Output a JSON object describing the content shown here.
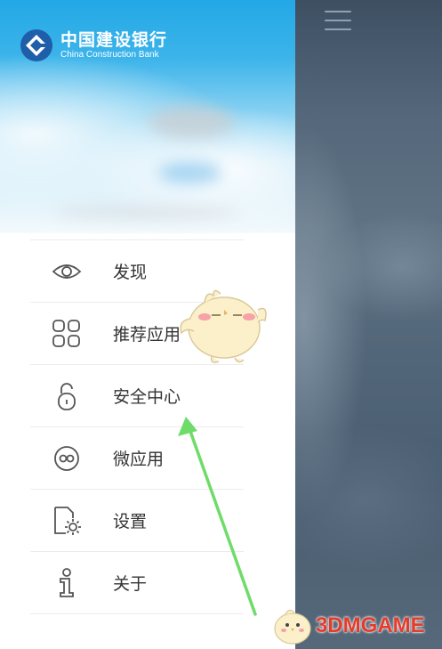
{
  "header": {
    "bank_name_cn": "中国建设银行",
    "bank_name_en": "China Construction Bank"
  },
  "menu": {
    "items": [
      {
        "label": "发现",
        "icon": "eye-icon"
      },
      {
        "label": "推荐应用",
        "icon": "grid-icon"
      },
      {
        "label": "安全中心",
        "icon": "lock-icon"
      },
      {
        "label": "微应用",
        "icon": "infinity-icon"
      },
      {
        "label": "设置",
        "icon": "settings-doc-icon"
      },
      {
        "label": "关于",
        "icon": "info-person-icon"
      }
    ]
  },
  "watermark": {
    "text": "3DMGAME"
  },
  "colors": {
    "header_blue": "#23a8e6",
    "menu_text": "#333333",
    "arrow_green": "#6fdc6a",
    "watermark_red": "#e43c2c"
  }
}
